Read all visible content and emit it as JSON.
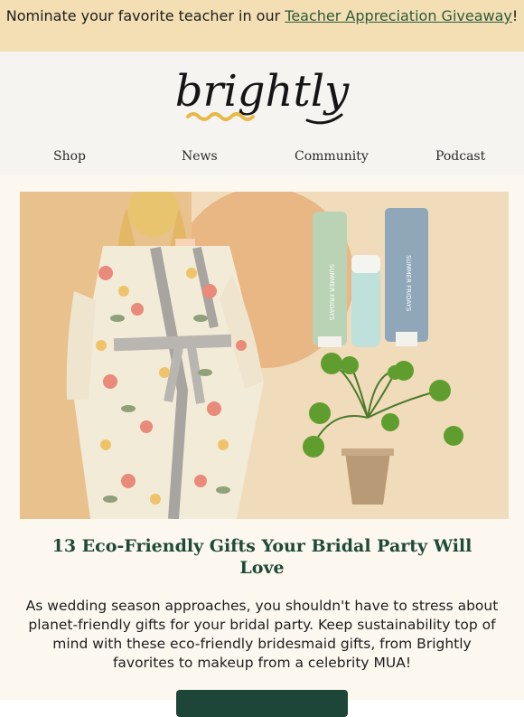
{
  "banner": {
    "text": "Nominate your favorite teacher in our ",
    "link": "Teacher Appreciation Giveaway",
    "suffix": "!"
  },
  "brand": {
    "logo_text": "brightly"
  },
  "nav": {
    "items": [
      "Shop",
      "News",
      "Community",
      "Podcast"
    ]
  },
  "article": {
    "title": "13 Eco-Friendly Gifts Your Bridal Party Will Love",
    "body": "As wedding season approaches, you shouldn't have to stress about planet-friendly gifts for your bridal party. Keep sustainability top of mind with these eco-friendly bridesmaid gifts, from Brightly favorites to makeup from a celebrity MUA!"
  },
  "hero": {
    "product_brand": "SUMMER FRIDAYS"
  },
  "colors": {
    "banner_bg": "#f3dfb3",
    "header_bg": "#f6f4f1",
    "accent_green": "#1f4a37",
    "link_green": "#2e5a3a",
    "wave_yellow": "#e8b94a"
  }
}
